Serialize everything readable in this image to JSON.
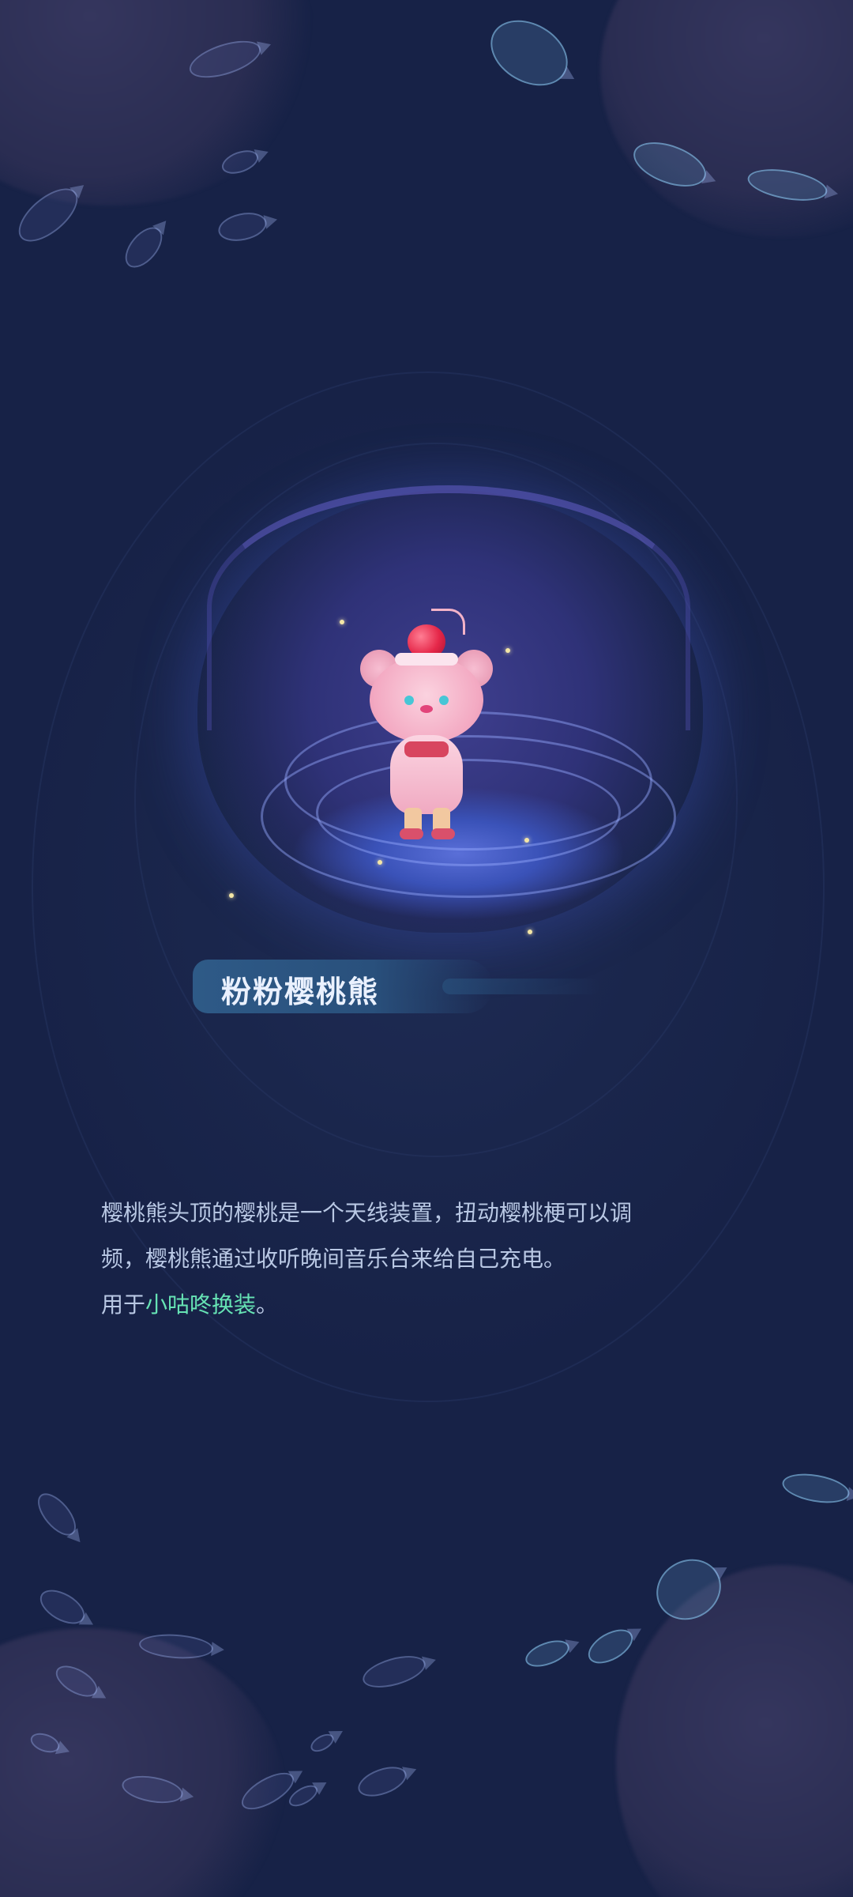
{
  "item": {
    "name": "粉粉樱桃熊",
    "description_line1": "樱桃熊头顶的樱桃是一个天线装置，扭动樱桃梗可以调",
    "description_line2": "频，樱桃熊通过收听晚间音乐台来给自己充电。",
    "usage_prefix": "用于",
    "usage_target": "小咕咚换装",
    "usage_suffix": "。"
  },
  "colors": {
    "background": "#182449",
    "highlight": "#66e3b4",
    "description_text": "#b9c8e4",
    "name_text": "#eaf1ff"
  }
}
